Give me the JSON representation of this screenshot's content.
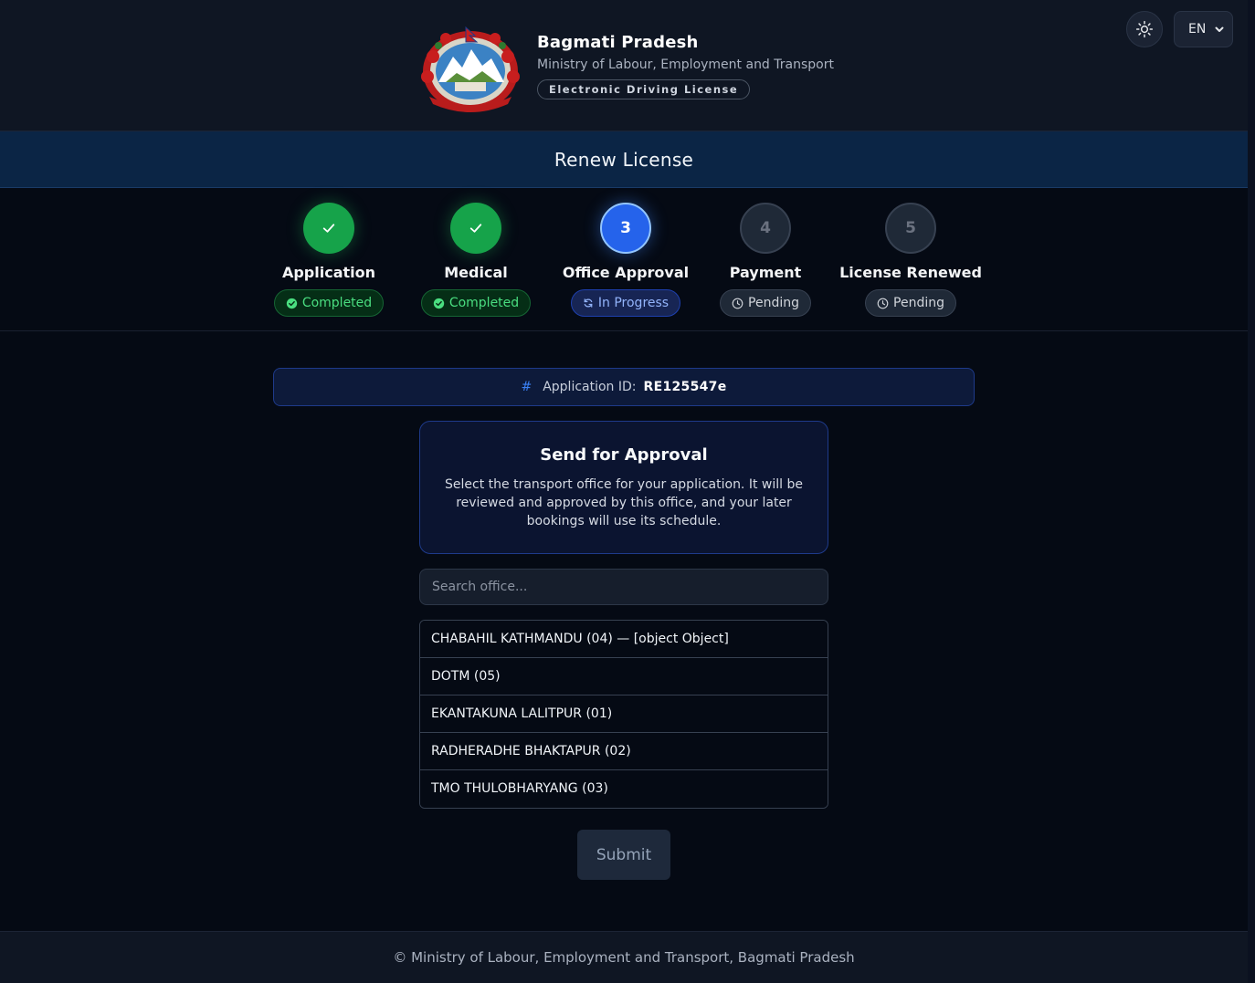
{
  "header": {
    "title": "Bagmati Pradesh",
    "subtitle": "Ministry of Labour, Employment and Transport",
    "badge": "Electronic Driving License",
    "emblem_icon": "nepal-emblem-icon",
    "theme_icon": "sun-icon",
    "language": "EN"
  },
  "page_title": "Renew License",
  "steps": [
    {
      "number": "1",
      "label": "Application",
      "status": "Completed",
      "state": "done"
    },
    {
      "number": "2",
      "label": "Medical",
      "status": "Completed",
      "state": "done"
    },
    {
      "number": "3",
      "label": "Office Approval",
      "status": "In Progress",
      "state": "active"
    },
    {
      "number": "4",
      "label": "Payment",
      "status": "Pending",
      "state": "pending"
    },
    {
      "number": "5",
      "label": "License Renewed",
      "status": "Pending",
      "state": "pending"
    }
  ],
  "application": {
    "hash": "#",
    "id_label": "Application ID:",
    "id_value": "RE125547e"
  },
  "approval": {
    "title": "Send for Approval",
    "description": "Select the transport office for your application. It will be reviewed and approved by this office, and your later bookings will use its schedule."
  },
  "search": {
    "placeholder": "Search office...",
    "value": ""
  },
  "offices": [
    "CHABAHIL KATHMANDU (04) — [object Object]",
    "DOTM (05)",
    "EKANTAKUNA LALITPUR (01)",
    "RADHERADHE BHAKTAPUR (02)",
    "TMO THULOBHARYANG (03)"
  ],
  "submit_label": "Submit",
  "footer": "© Ministry of Labour, Employment and Transport, Bagmati Pradesh",
  "colors": {
    "background": "#050a14",
    "header": "#0f1623",
    "title_bar": "#0b2545",
    "done": "#16a34a",
    "active": "#2563eb",
    "pending": "#1f2937"
  }
}
